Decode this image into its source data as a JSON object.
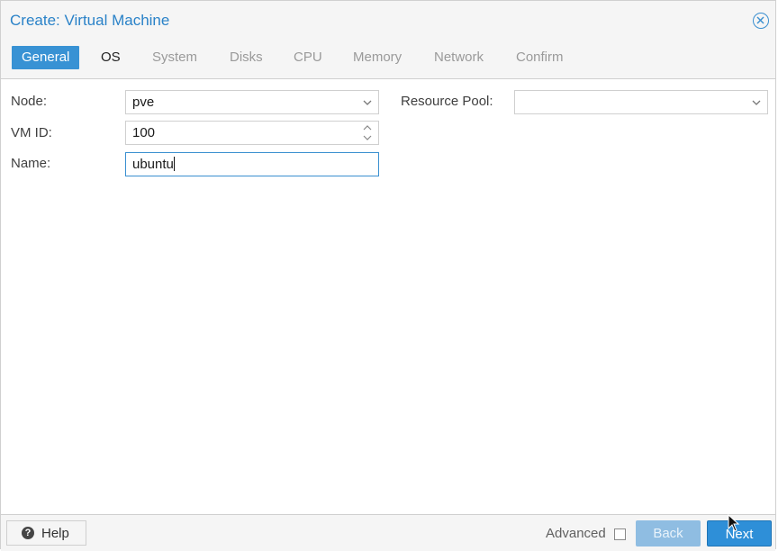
{
  "window": {
    "title": "Create: Virtual Machine"
  },
  "tabs": [
    {
      "label": "General",
      "state": "active"
    },
    {
      "label": "OS",
      "state": "enabled"
    },
    {
      "label": "System",
      "state": "disabled"
    },
    {
      "label": "Disks",
      "state": "disabled"
    },
    {
      "label": "CPU",
      "state": "disabled"
    },
    {
      "label": "Memory",
      "state": "disabled"
    },
    {
      "label": "Network",
      "state": "disabled"
    },
    {
      "label": "Confirm",
      "state": "disabled"
    }
  ],
  "form": {
    "node": {
      "label": "Node:",
      "value": "pve"
    },
    "vmid": {
      "label": "VM ID:",
      "value": "100"
    },
    "name": {
      "label": "Name:",
      "value": "ubuntu"
    },
    "resource_pool": {
      "label": "Resource Pool:",
      "value": ""
    }
  },
  "footer": {
    "help_label": "Help",
    "advanced_label": "Advanced",
    "advanced_checked": false,
    "back_label": "Back",
    "next_label": "Next"
  },
  "colors": {
    "accent": "#3892d4",
    "title": "#2a82c8",
    "disabled_tab": "#9a9a9a"
  },
  "icons": {
    "close": "close-circle-icon",
    "dropdown": "chevron-down-icon",
    "spinner": "spinner-arrows-icon",
    "help": "question-circle-icon",
    "cursor": "mouse-pointer-icon"
  }
}
